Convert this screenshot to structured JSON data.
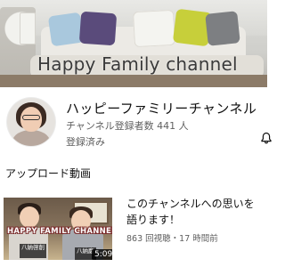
{
  "banner": {
    "title": "Happy Family channel"
  },
  "channel": {
    "name": "ハッピーファミリーチャンネル",
    "subscribers": "チャンネル登録者数 441 人",
    "subscribed_label": "登録済み"
  },
  "uploads": {
    "section_title": "アップロード動画",
    "videos": [
      {
        "title": "このチャンネルへの思いを語ります！",
        "thumbnail_text": "HAPPY FAMILY CHANNEL",
        "name_tags": [
          "八納啓創",
          "八納慶"
        ],
        "duration": "5:09",
        "meta": "863 回視聴・17 時間前"
      }
    ]
  },
  "icons": {
    "notification": "bell-icon"
  },
  "colors": {
    "text_primary": "#0f0f0f",
    "text_secondary": "#606060",
    "thumbnail_title_outline": "#7a2c2c"
  }
}
